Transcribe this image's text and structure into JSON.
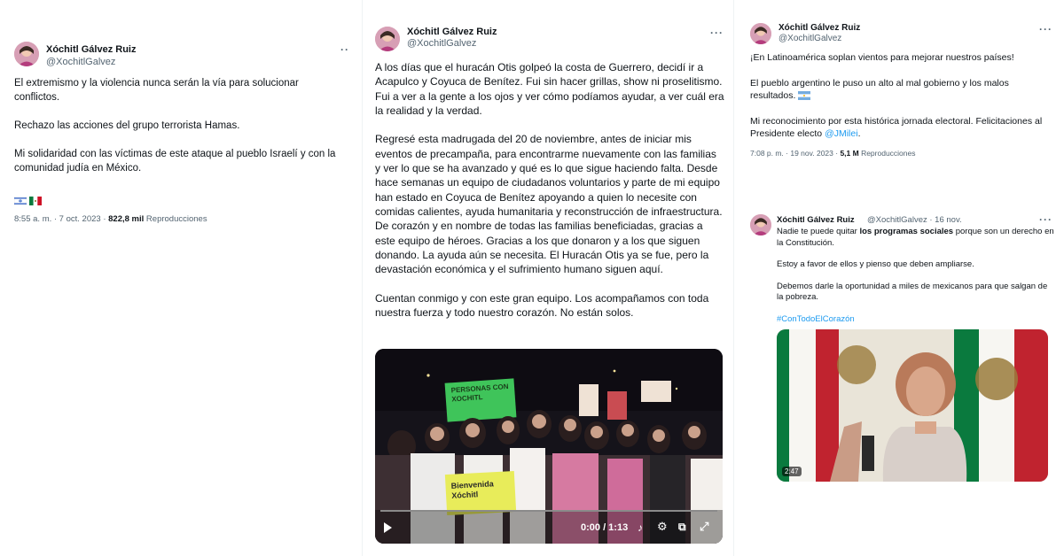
{
  "tweet1": {
    "name": "Xóchitl Gálvez Ruiz",
    "handle": "@XochitlGalvez",
    "more": "··",
    "paragraphs": [
      "El extremismo y la violencia nunca serán la vía para solucionar conflictos.",
      "Rechazo las acciones del grupo terrorista Hamas.",
      "Mi solidaridad con las víctimas de este ataque al pueblo Israelí y con la comunidad judía en México."
    ],
    "flags": [
      "israel-flag",
      "mexico-flag"
    ],
    "time": "8:55 a. m. · 7 oct. 2023 · ",
    "views": "822,8 mil",
    "views_label": " Reproducciones"
  },
  "tweet2": {
    "name": "Xóchitl Gálvez Ruiz",
    "handle": "@XochitlGalvez",
    "more": "···",
    "paragraphs": [
      "A los días que el huracán Otis golpeó la costa de Guerrero, decidí ir a Acapulco y Coyuca de Benítez. Fui sin hacer grillas, show ni proselitismo. Fui a ver a la gente a los ojos y ver cómo podíamos ayudar, a ver cuál era la realidad y la verdad.",
      " Regresé esta madrugada del 20 de noviembre, antes de iniciar mis eventos de precampaña, para encontrarme nuevamente con las familias y ver lo que se ha avanzado y qué es lo que sigue haciendo falta. Desde hace semanas un equipo de ciudadanos voluntarios y parte de mi equipo han estado en Coyuca de Benítez apoyando a quien lo necesite con comidas calientes, ayuda humanitaria y reconstrucción de infraestructura. De corazón y en nombre de todas las familias beneficiadas, gracias a este equipo de héroes. Gracias a los que donaron y a los que siguen donando. La ayuda aún se necesita. El Huracán Otis ya se fue, pero la devastación económica y el sufrimiento humano siguen aquí.",
      "Cuentan conmigo y con este gran equipo. Los acompañamos con toda nuestra fuerza y todo nuestro corazón. No están solos."
    ],
    "video": {
      "time": "0:00 / 1:13",
      "progress": 0,
      "sign_top": "PERSONAS CON XOCHITL",
      "sign_bottom": "Bienvenida Xóchitl"
    }
  },
  "tweet3": {
    "name": "Xóchitl Gálvez Ruiz",
    "handle": "@XochitlGalvez",
    "more": "···",
    "p1": "¡En Latinoamérica soplan vientos para mejorar nuestros países!",
    "p2": "El pueblo argentino le puso un alto al mal gobierno y los malos resultados.",
    "p3_prefix": "Mi reconocimiento por esta histórica jornada electoral. Felicitaciones al Presidente electo ",
    "p3_mention": "@JMilei",
    "p3_suffix": ".",
    "flag": "argentina-flag",
    "time": "7:08 p. m. · 19 nov. 2023 · ",
    "views": "5,1 M",
    "views_label": " Reproducciones"
  },
  "tweet4": {
    "name": "Xóchitl Gálvez Ruiz",
    "handle_date": "@XochitlGalvez · 16 nov.",
    "more": "···",
    "p1_prefix": "Nadie te puede quitar ",
    "p1_bold": "los programas sociales",
    "p1_suffix": " porque son un derecho en la Constitución.",
    "p2": "Estoy a favor de ellos y pienso que deben ampliarse.",
    "p3": "Debemos darle la oportunidad a miles de mexicanos para que salgan de la pobreza.",
    "hashtag": "#ConTodoElCorazón",
    "video": {
      "duration": "2:47"
    }
  }
}
